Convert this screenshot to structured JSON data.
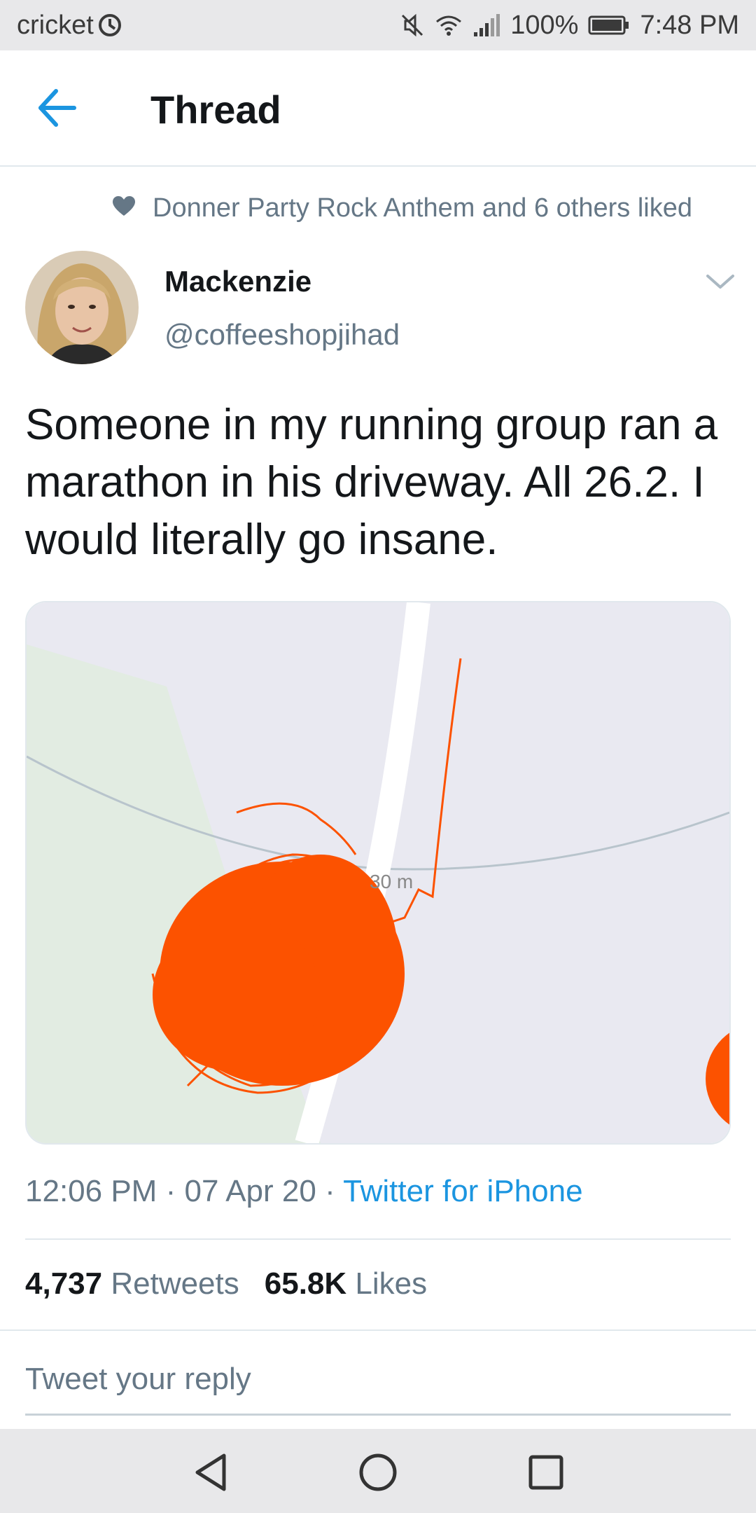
{
  "status_bar": {
    "carrier": "cricket",
    "battery": "100%",
    "time": "7:48 PM"
  },
  "header": {
    "title": "Thread"
  },
  "social_context": {
    "text": "Donner Party Rock Anthem and 6 others liked"
  },
  "author": {
    "name": "Mackenzie",
    "handle": "@coffeeshopjihad"
  },
  "tweet": {
    "text": "Someone in my running group ran a marathon in his driveway. All 26.2. I would literally go insane.",
    "map_label": "30 m",
    "time": "12:06 PM",
    "date": "07 Apr 20",
    "source": "Twitter for iPhone",
    "sep": "·"
  },
  "stats": {
    "retweets_count": "4,737",
    "retweets_label": "Retweets",
    "likes_count": "65.8K",
    "likes_label": "Likes"
  },
  "reply": {
    "placeholder": "Tweet your reply"
  },
  "colors": {
    "accent": "#1b95e0",
    "route": "#fc5200",
    "muted": "#657786"
  }
}
